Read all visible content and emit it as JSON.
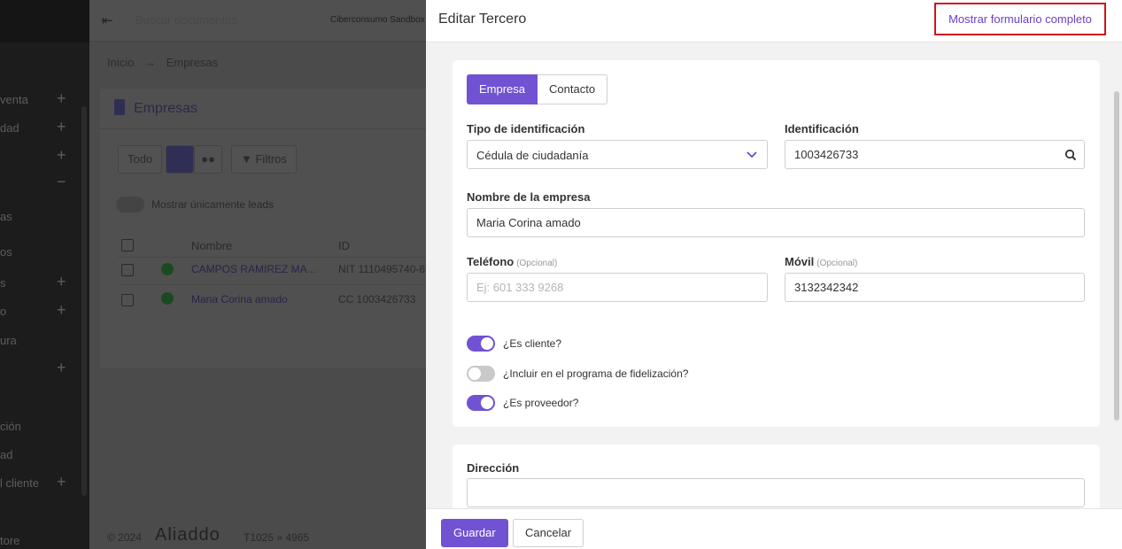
{
  "background": {
    "sidebar": {
      "items": [
        {
          "label": "venta",
          "suffix": "+"
        },
        {
          "label": "dad",
          "suffix": "+"
        },
        {
          "label": "",
          "suffix": "+"
        },
        {
          "label": "",
          "suffix": "−"
        },
        {
          "label": "as",
          "suffix": ""
        },
        {
          "label": "os",
          "suffix": ""
        },
        {
          "label": "s",
          "suffix": "+"
        },
        {
          "label": "o",
          "suffix": "+"
        },
        {
          "label": "ura",
          "suffix": ""
        },
        {
          "label": "",
          "suffix": "+"
        },
        {
          "label": "ción",
          "suffix": ""
        },
        {
          "label": "ad",
          "suffix": ""
        },
        {
          "label": "l cliente",
          "suffix": "+"
        },
        {
          "label": "tore",
          "suffix": ""
        }
      ]
    },
    "topbar": {
      "search_placeholder": "Buscar documentos",
      "company": "Ciberconsumo Sandbox S.A."
    },
    "breadcrumb": {
      "home": "Inicio",
      "separator": "→",
      "current": "Empresas"
    },
    "page_title": "Empresas",
    "filters": {
      "all": "Todo",
      "filters": "Filtros"
    },
    "leads_toggle_label": "Mostrar únicamente leads",
    "table": {
      "columns": [
        "Nombre",
        "ID"
      ],
      "rows": [
        {
          "name": "CAMPOS RAMIREZ MA...",
          "id": "NIT 1110495740-6"
        },
        {
          "name": "Maria Corina amado",
          "id": "CC 1003426733"
        }
      ]
    },
    "footer": {
      "copyright": "© 2024",
      "logo": "Aliaddo",
      "version": "T1025 » 4965"
    }
  },
  "panel": {
    "title": "Editar Tercero",
    "show_full_form": "Mostrar formulario completo",
    "tabs": [
      {
        "label": "Empresa",
        "active": true
      },
      {
        "label": "Contacto",
        "active": false
      }
    ],
    "fields": {
      "id_type": {
        "label": "Tipo de identificación",
        "value": "Cédula de ciudadanía"
      },
      "identification": {
        "label": "Identificación",
        "value": "1003426733"
      },
      "company_name": {
        "label": "Nombre de la empresa",
        "value": "Maria Corina amado"
      },
      "phone": {
        "label": "Teléfono",
        "optional": "(Opcional)",
        "value": "",
        "placeholder": "Ej: 601 333 9268"
      },
      "mobile": {
        "label": "Móvil",
        "optional": "(Opcional)",
        "value": "3132342342"
      },
      "address": {
        "label": "Dirección",
        "value": ""
      }
    },
    "toggles": [
      {
        "label": "¿Es cliente?",
        "on": true
      },
      {
        "label": "¿Incluir en el programa de fidelización?",
        "on": false
      },
      {
        "label": "¿Es proveedor?",
        "on": true
      }
    ],
    "buttons": {
      "save": "Guardar",
      "cancel": "Cancelar"
    },
    "colors": {
      "accent": "#7052d3",
      "highlight_border": "#d0121f",
      "link": "#6b3fc9"
    }
  }
}
